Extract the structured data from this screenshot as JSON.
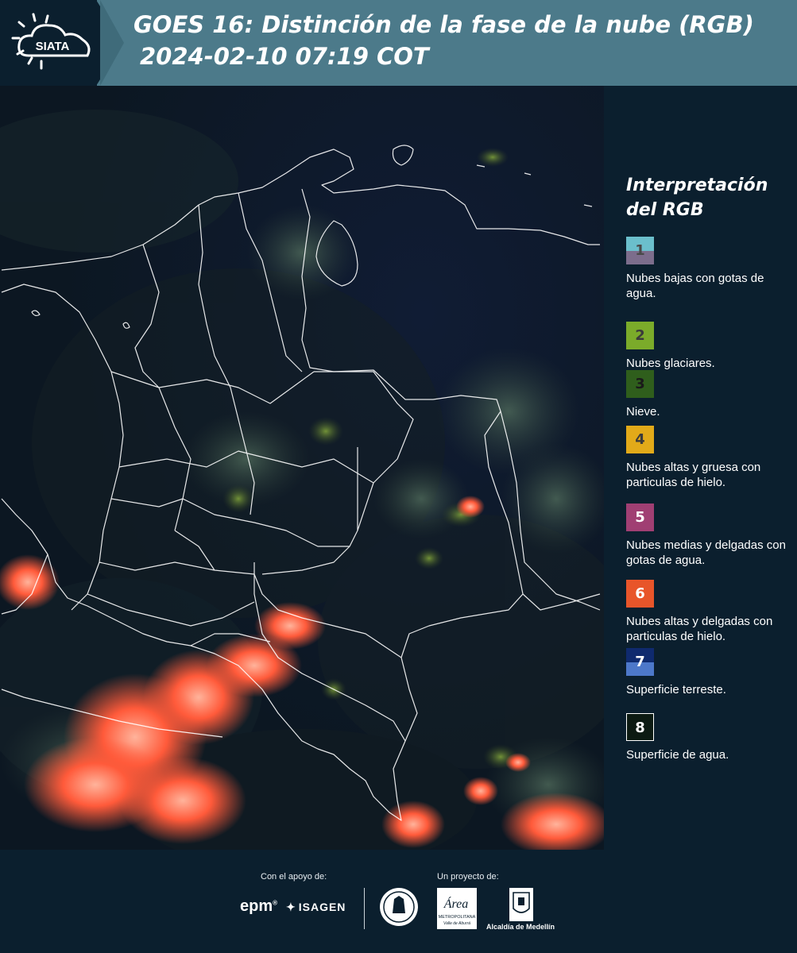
{
  "header": {
    "logo_text": "SIATA",
    "title": "GOES 16: Distinción de la fase de la nube (RGB)",
    "timestamp": "2024-02-10 07:19 COT"
  },
  "legend": {
    "title_line1": "Interpretación",
    "title_line2": "del RGB",
    "items": [
      {
        "number": "1",
        "label": "Nubes bajas con gotas de agua.",
        "color_top": "#6bbfcc",
        "color_bottom": "#7c6d8c",
        "num_color": "#4a4a4a"
      },
      {
        "number": "2",
        "label": "Nubes glaciares.",
        "color_top": "#7bab2a",
        "color_bottom": "#7bab2a",
        "num_color": "#3b3b3b"
      },
      {
        "number": "3",
        "label": "Nieve.",
        "color_top": "#2f5e1c",
        "color_bottom": "#2f5e1c",
        "num_color": "#1a1a1a"
      },
      {
        "number": "4",
        "label": "Nubes altas y gruesa con particulas de hielo.",
        "color_top": "#e2aa19",
        "color_bottom": "#e2aa19",
        "num_color": "#3b3b3b"
      },
      {
        "number": "5",
        "label": "Nubes medias y delgadas con gotas de agua.",
        "color_top": "#a03f73",
        "color_bottom": "#a03f73",
        "num_color": "#ffffff"
      },
      {
        "number": "6",
        "label": "Nubes altas y delgadas con particulas de hielo.",
        "color_top": "#e8552a",
        "color_bottom": "#e8552a",
        "num_color": "#ffffff"
      },
      {
        "number": "7",
        "label": "Superficie terreste.",
        "color_top": "#0f2a6e",
        "color_bottom": "#4d78c9",
        "num_color": "#ffffff"
      },
      {
        "number": "8",
        "label": "Superficie de agua.",
        "color_top": "#0c1a12",
        "color_bottom": "#0c1a12",
        "num_color": "#ffffff"
      }
    ]
  },
  "footer": {
    "support_label": "Con el apoyo de:",
    "project_label": "Un proyecto de:",
    "epm": "epm",
    "isagen": "ISAGEN",
    "area_text": "Área",
    "metropolitana_text": "METROPOLITANA",
    "valle_text": "Valle de Aburrá",
    "alcaldia_text": "Alcaldía de Medellín"
  },
  "colors": {
    "background": "#0b1f2e",
    "header_bar": "#4c7a8a",
    "cloud_hot": "#ff5a3a",
    "border_line": "#ffffff"
  }
}
